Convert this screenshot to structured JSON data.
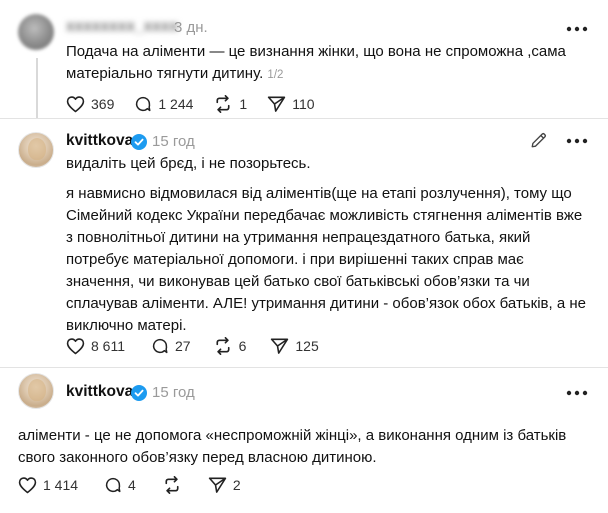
{
  "posts": [
    {
      "username": "xxxxxxxx_xxxx",
      "time": "3 дн.",
      "text": "Подача на аліменти — це визнання жінки, що вона не спроможна ,сама\nматеріально тягнути дитину.",
      "page_counter": "1/2",
      "likes": "369",
      "comments": "1 244",
      "reposts": "1",
      "shares": "110"
    },
    {
      "username": "kvittkova",
      "time": "15 год",
      "text_first": "видаліть цей брєд, і не позорьтесь.",
      "text_second": "я навмисно відмовилася від аліментів(ще на етапі розлучення), тому що\nСімейний кодекс України передбачає можливість стягнення аліментів вже\nз повнолітньої дитини на утримання непрацездатного батька, який\nпотребує матеріальної допомоги. і при вирішенні таких справ має\nзначення, чи виконував цей батько свої батьківські обов’язки та чи\nсплачував аліменти. АЛЕ! утримання дитини - обов’язок обох батьків, а не\nвиключно матері.",
      "likes": "8 611",
      "comments": "27",
      "reposts": "6",
      "shares": "125"
    },
    {
      "username": "kvittkova",
      "time": "15 год",
      "text": "аліменти - це не допомога «неспроможній жінці», а виконання одним із батьків\nсвого законного обов’язку перед власною дитиною.",
      "likes": "1 414",
      "comments": "4",
      "reposts": "",
      "shares": "2"
    }
  ],
  "colors": {
    "verified": "#1d9bf0",
    "muted": "#9a9a9a",
    "divider": "#e3e3e3"
  },
  "icons": [
    "more-icon",
    "edit-icon",
    "heart-icon",
    "comment-icon",
    "repost-icon",
    "share-icon",
    "verified-icon"
  ]
}
